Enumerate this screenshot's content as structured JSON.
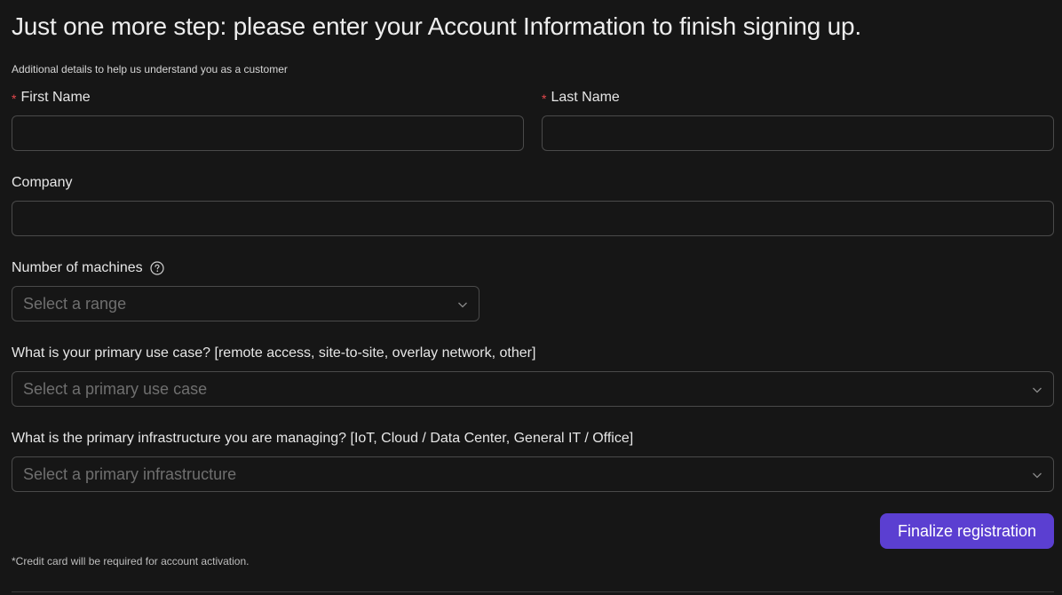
{
  "header": {
    "title": "Just one more step: please enter your Account Information to finish signing up.",
    "subtitle": "Additional details to help us understand you as a customer"
  },
  "form": {
    "required_marker": "*",
    "first_name": {
      "label": "First Name",
      "value": "",
      "placeholder": ""
    },
    "last_name": {
      "label": "Last Name",
      "value": "",
      "placeholder": ""
    },
    "company": {
      "label": "Company",
      "value": "",
      "placeholder": ""
    },
    "machines": {
      "label": "Number of machines",
      "placeholder": "Select a range",
      "help_icon": "question-circle-icon"
    },
    "use_case": {
      "label": "What is your primary use case? [remote access, site-to-site, overlay network, other]",
      "placeholder": "Select a primary use case"
    },
    "infrastructure": {
      "label": "What is the primary infrastructure you are managing? [IoT, Cloud / Data Center, General IT / Office]",
      "placeholder": "Select a primary infrastructure"
    },
    "submit_label": "Finalize registration",
    "footnote": "*Credit card will be required for account activation."
  },
  "colors": {
    "background": "#161616",
    "accent": "#5b3fd1",
    "required": "#e5484d",
    "border": "#4a4a4a"
  }
}
